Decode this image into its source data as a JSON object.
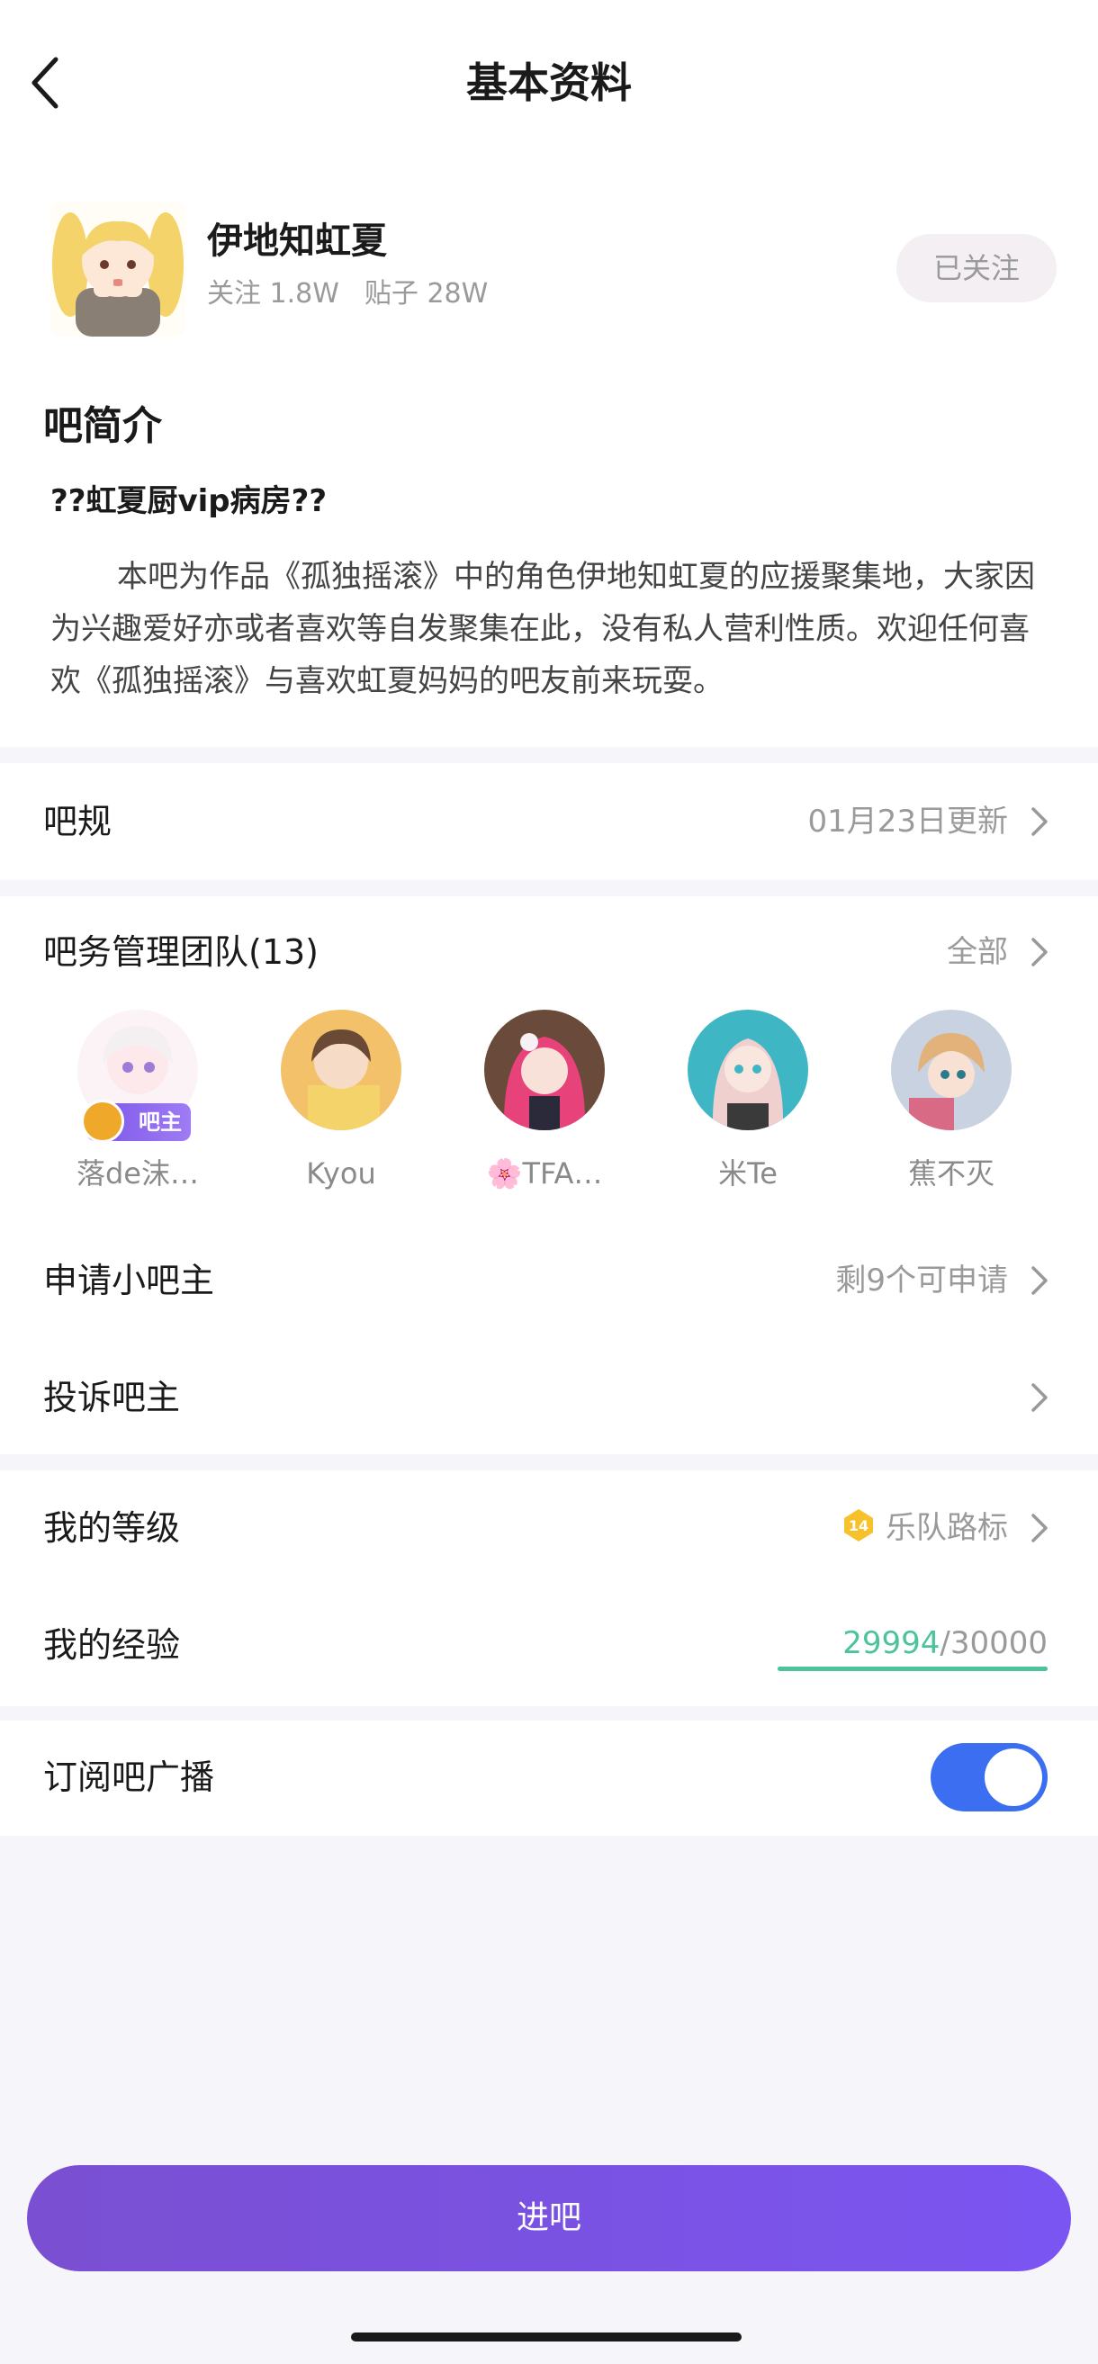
{
  "header": {
    "title": "基本资料"
  },
  "forum": {
    "name": "伊地知虹夏",
    "stats": {
      "followers": "关注 1.8W",
      "posts": "贴子 28W"
    },
    "follow_label": "已关注"
  },
  "intro": {
    "heading": "吧简介",
    "subtitle": "??虹夏厨vip病房??",
    "body": "本吧为作品《孤独摇滚》中的角色伊地知虹夏的应援聚集地，大家因为兴趣爱好亦或者喜欢等自发聚集在此，没有私人营利性质。欢迎任何喜欢《孤独摇滚》与喜欢虹夏妈妈的吧友前来玩耍。"
  },
  "rules": {
    "label": "吧规",
    "value": "01月23日更新"
  },
  "team": {
    "label": "吧务管理团队(13)",
    "all_label": "全部",
    "members": [
      {
        "name": "落de沫…",
        "badge": "吧主"
      },
      {
        "name": "Kyou"
      },
      {
        "name": "🌸TFA…"
      },
      {
        "name": "米Te"
      },
      {
        "name": "蕉不灭"
      }
    ]
  },
  "apply": {
    "label": "申请小吧主",
    "value": "剩9个可申请"
  },
  "complain": {
    "label": "投诉吧主"
  },
  "level": {
    "label": "我的等级",
    "number": "14",
    "title": "乐队路标"
  },
  "experience": {
    "label": "我的经验",
    "current": "29994",
    "total": "/30000",
    "progress": 0.9998
  },
  "subscribe": {
    "label": "订阅吧广播",
    "enabled": true
  },
  "enter_label": "进吧",
  "colors": {
    "accent": "#7b55f2",
    "toggle": "#3b6ef0",
    "exp": "#4cc39a"
  }
}
